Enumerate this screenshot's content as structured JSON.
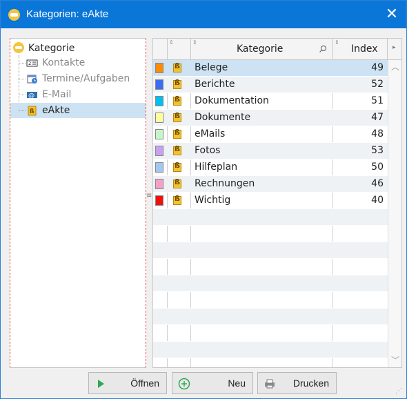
{
  "window": {
    "title": "Kategorien: eAkte",
    "close_label": "✕"
  },
  "tree": {
    "root": "Kategorie",
    "items": [
      {
        "label": "Kontakte",
        "icon": "contacts-icon"
      },
      {
        "label": "Termine/Aufgaben",
        "icon": "calendar-icon"
      },
      {
        "label": "E-Mail",
        "icon": "email-icon"
      },
      {
        "label": "eAkte",
        "icon": "folder-icon",
        "selected": true
      }
    ]
  },
  "grid": {
    "columns": {
      "category": "Kategorie",
      "index": "Index"
    },
    "rows": [
      {
        "color": "#ff8c00",
        "name": "Belege",
        "index": "49"
      },
      {
        "color": "#3a6cf4",
        "name": "Berichte",
        "index": "52"
      },
      {
        "color": "#00c0f0",
        "name": "Dokumentation",
        "index": "51"
      },
      {
        "color": "#ffffa0",
        "name": "Dokumente",
        "index": "47"
      },
      {
        "color": "#c8f5c8",
        "name": "eMails",
        "index": "48"
      },
      {
        "color": "#c8a0f0",
        "name": "Fotos",
        "index": "53"
      },
      {
        "color": "#a0c8f0",
        "name": "Hilfeplan",
        "index": "50"
      },
      {
        "color": "#f5a0c8",
        "name": "Rechnungen",
        "index": "46"
      },
      {
        "color": "#ee1111",
        "name": "Wichtig",
        "index": "40"
      }
    ]
  },
  "buttons": {
    "open": "Öffnen",
    "new": "Neu",
    "print": "Drucken"
  }
}
